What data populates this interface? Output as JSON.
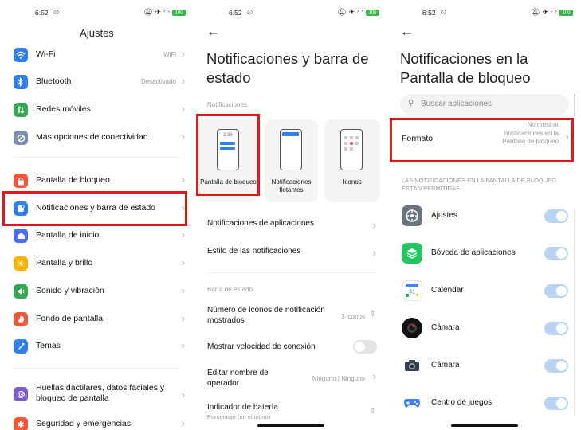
{
  "status": {
    "time": "6:52",
    "battery": "100"
  },
  "settings": {
    "title": "Ajustes",
    "items": [
      {
        "label": "Wi-Fi",
        "value": "WiFi",
        "icon": "wifi-icon",
        "color": "#2f80ed"
      },
      {
        "label": "Bluetooth",
        "value": "Desactivado",
        "icon": "bluetooth-icon",
        "color": "#2f80ed"
      },
      {
        "label": "Redes móviles",
        "value": "",
        "icon": "mobile-data-icon",
        "color": "#34a853"
      },
      {
        "label": "Más opciones de conectividad",
        "value": "",
        "icon": "link-icon",
        "color": "#7b8fb3"
      },
      {
        "label": "Pantalla de bloqueo",
        "value": "",
        "icon": "lock-icon",
        "color": "#f0563a"
      },
      {
        "label": "Notificaciones y barra de estado",
        "value": "",
        "icon": "notification-icon",
        "color": "#2f80ed"
      },
      {
        "label": "Pantalla de inicio",
        "value": "",
        "icon": "home-icon",
        "color": "#4a6cf0"
      },
      {
        "label": "Pantalla y brillo",
        "value": "",
        "icon": "brightness-icon",
        "color": "#f5b400"
      },
      {
        "label": "Sonido y vibración",
        "value": "",
        "icon": "sound-icon",
        "color": "#34a853"
      },
      {
        "label": "Fondo de pantalla",
        "value": "",
        "icon": "wallpaper-icon",
        "color": "#f0563a"
      },
      {
        "label": "Temas",
        "value": "",
        "icon": "brush-icon",
        "color": "#2f80ed"
      },
      {
        "label": "Huellas dactilares, datos faciales y bloqueo de pantalla",
        "value": "",
        "icon": "fingerprint-icon",
        "color": "#7b5cd6"
      },
      {
        "label": "Seguridad y emergencias",
        "value": "",
        "icon": "emergency-icon",
        "color": "#f0563a"
      }
    ]
  },
  "notif": {
    "title": "Notificaciones y barra de estado",
    "section_notifications": "Notificaciones",
    "cards": [
      {
        "label": "Pantalla de bloqueo",
        "clock": "2:36"
      },
      {
        "label": "Notificaciones flotantes"
      },
      {
        "label": "Iconos"
      }
    ],
    "rows": {
      "app_notifications": "Notificaciones de aplicaciones",
      "notif_style": "Estilo de las notificaciones"
    },
    "section_status_bar": "Barra de estado",
    "status_rows": {
      "icon_count_label": "Número de iconos de notificación mostrados",
      "icon_count_value": "3 iconos",
      "speed_label": "Mostrar velocidad de conexión",
      "operator_label": "Editar nombre de operador",
      "operator_value": "Ninguno | Ninguno",
      "battery_label": "Indicador de batería",
      "battery_sub": "Porcentaje (en el icono)"
    }
  },
  "lock": {
    "title": "Notificaciones en la Pantalla de bloqueo",
    "search_placeholder": "Buscar aplicaciones",
    "format_label": "Formato",
    "format_value": "No mostrar notificaciones en la Pantalla de bloqueo",
    "allowed_label": "LAS NOTIFICACIONES EN LA PANTALLA DE BLOQUEO ESTÁN PERMITIDAS",
    "apps": [
      {
        "label": "Ajustes",
        "icon": "settings-gear-icon",
        "color": "#6b7280"
      },
      {
        "label": "Bóveda de aplicaciones",
        "icon": "app-vault-icon",
        "color": "#22c55e"
      },
      {
        "label": "Calendar",
        "icon": "calendar-icon",
        "color": "#ffffff"
      },
      {
        "label": "Cámara",
        "icon": "camera-icon",
        "color": "#111111"
      },
      {
        "label": "Cámara",
        "icon": "camera-icon",
        "color": "#374151"
      },
      {
        "label": "Centro de juegos",
        "icon": "gamepad-icon",
        "color": "#ffffff"
      }
    ]
  }
}
